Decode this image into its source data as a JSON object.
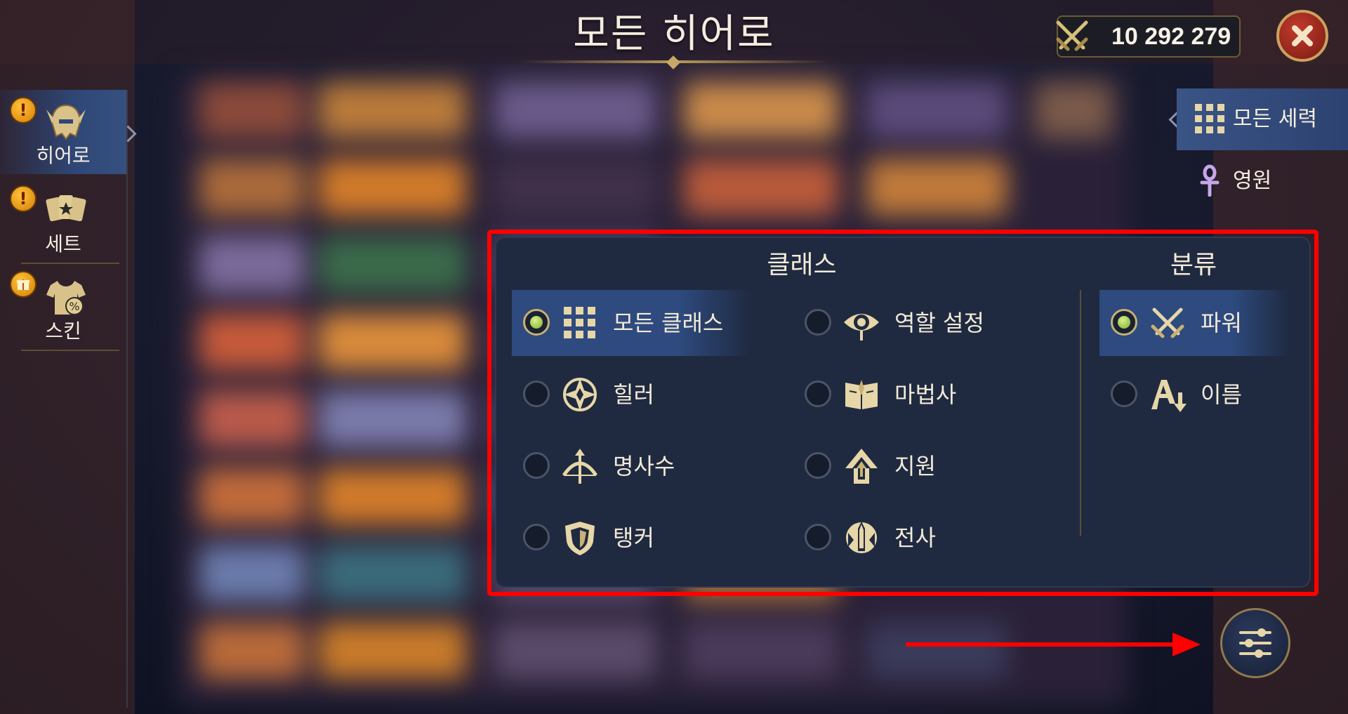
{
  "header": {
    "title": "모든 히어로",
    "power_value": "10 292 279"
  },
  "left_nav": {
    "items": [
      {
        "label": "히어로",
        "icon": "helmet-icon",
        "active": true,
        "alert": "!"
      },
      {
        "label": "세트",
        "icon": "cards-icon",
        "active": false,
        "alert": "!"
      },
      {
        "label": "스킨",
        "icon": "shirt-icon",
        "active": false,
        "alert": "gift"
      }
    ]
  },
  "right_nav": {
    "items": [
      {
        "label": "모든 세력",
        "icon": "grid-icon",
        "active": true
      },
      {
        "label": "영원",
        "icon": "ankh-icon",
        "active": false
      }
    ]
  },
  "filter_panel": {
    "class_header": "클래스",
    "sort_header": "분류",
    "classes": [
      {
        "label": "모든 클래스",
        "icon": "grid-icon",
        "selected": true
      },
      {
        "label": "역할 설정",
        "icon": "eye-icon",
        "selected": false
      },
      {
        "label": "힐러",
        "icon": "healer-icon",
        "selected": false
      },
      {
        "label": "마법사",
        "icon": "spellbook-icon",
        "selected": false
      },
      {
        "label": "명사수",
        "icon": "bow-icon",
        "selected": false
      },
      {
        "label": "지원",
        "icon": "support-arrow-icon",
        "selected": false
      },
      {
        "label": "탱커",
        "icon": "shield-icon",
        "selected": false
      },
      {
        "label": "전사",
        "icon": "warrior-icon",
        "selected": false
      }
    ],
    "sort": [
      {
        "label": "파워",
        "icon": "crossed-swords-icon",
        "selected": true
      },
      {
        "label": "이름",
        "icon": "alpha-sort-icon",
        "selected": false
      }
    ]
  },
  "colors": {
    "accent_gold": "#c9a25e",
    "selected_row": "#2e4a7e",
    "annotation_red": "#ff0000",
    "radio_on": "#9bc43a"
  }
}
